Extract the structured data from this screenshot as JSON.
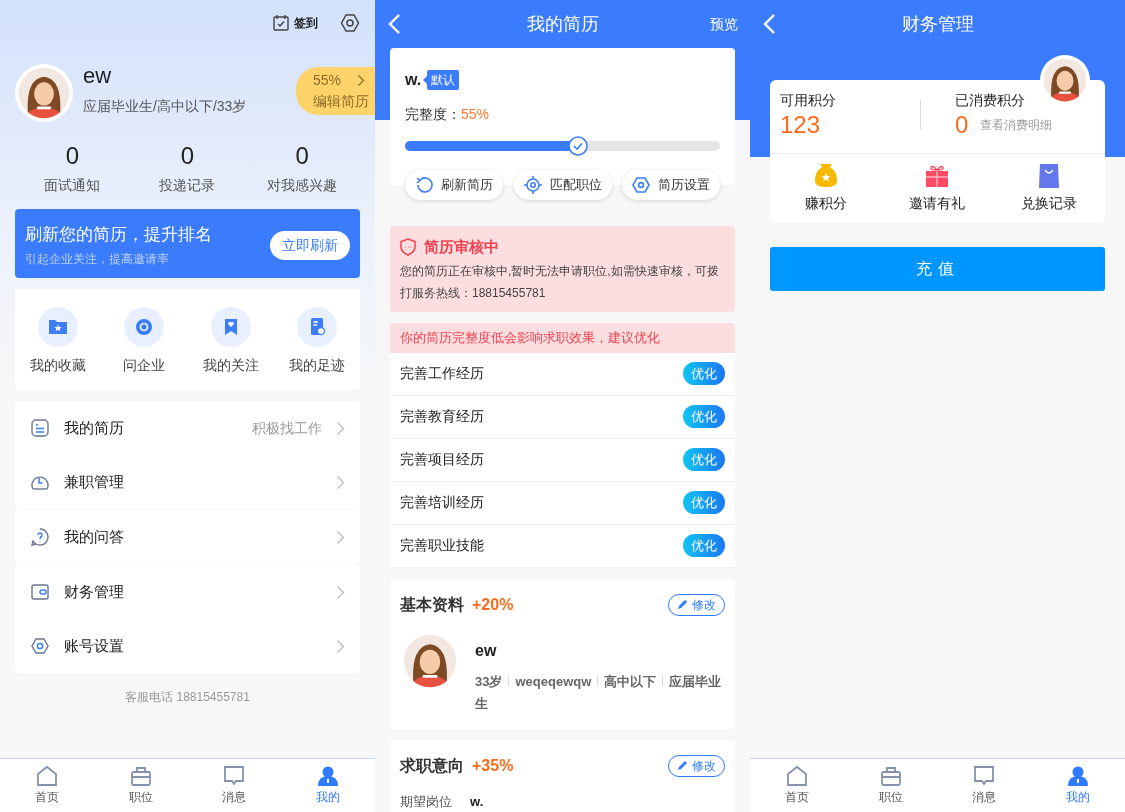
{
  "profile": {
    "sign_in": "签到",
    "name": "ew",
    "subtitle": "应届毕业生/高中以下/33岁",
    "completion": "55%",
    "edit_resume": "编辑简历",
    "stats": [
      {
        "value": "0",
        "label": "面试通知"
      },
      {
        "value": "0",
        "label": "投递记录"
      },
      {
        "value": "0",
        "label": "对我感兴趣"
      }
    ],
    "banner": {
      "title": "刷新您的简历，提升排名",
      "subtitle": "引起企业关注，提高邀请率",
      "button": "立即刷新"
    },
    "shortcuts": [
      "我的收藏",
      "问企业",
      "我的关注",
      "我的足迹"
    ],
    "menu_groups": [
      {
        "items": [
          {
            "label": "我的简历",
            "value": "积极找工作"
          },
          {
            "label": "兼职管理"
          }
        ]
      },
      {
        "items": [
          {
            "label": "我的问答"
          }
        ]
      },
      {
        "items": [
          {
            "label": "财务管理"
          },
          {
            "label": "账号设置"
          }
        ]
      }
    ],
    "hotline": "客服电话 18815455781",
    "tab_bar": [
      {
        "label": "首页",
        "selected": false
      },
      {
        "label": "职位",
        "selected": false
      },
      {
        "label": "消息",
        "selected": false
      },
      {
        "label": "我的",
        "selected": true
      }
    ]
  },
  "resume": {
    "title": "我的简历",
    "preview": "预览",
    "name": "w.",
    "tag": "默认",
    "completeness_label": "完整度：",
    "completeness": "55%",
    "level": 0.55,
    "actions": [
      "刷新简历",
      "匹配职位",
      "简历设置"
    ],
    "review": {
      "title": "简历审核中",
      "text": "您的简历正在审核中,暂时无法申请职位,如需快速审核，可拨打服务热线：18815455781"
    },
    "warning": "你的简历完整度低会影响求职效果，建议优化",
    "tasks": [
      {
        "label": "完善工作经历",
        "button": "优化"
      },
      {
        "label": "完善教育经历",
        "button": "优化"
      },
      {
        "label": "完善项目经历",
        "button": "优化"
      },
      {
        "label": "完善培训经历",
        "button": "优化"
      },
      {
        "label": "完善职业技能",
        "button": "优化"
      }
    ],
    "basic": {
      "title": "基本资料",
      "bonus": "+20%",
      "edit": "修改",
      "name": "ew",
      "details": [
        "33岁",
        "weqeqewqw",
        "高中以下",
        "应届毕业生"
      ]
    },
    "intent": {
      "title": "求职意向",
      "bonus": "+35%",
      "edit": "修改",
      "fields": [
        {
          "label": "期望岗位",
          "value": "w."
        }
      ]
    }
  },
  "finance": {
    "title": "财务管理",
    "available_label": "可用积分",
    "available": "123",
    "spent_label": "已消费积分",
    "spent": "0",
    "spent_link": "查看消费明细",
    "actions": [
      "赚积分",
      "邀请有礼",
      "兑换记录"
    ],
    "recharge": "充值",
    "tab_bar": [
      {
        "label": "首页",
        "selected": false
      },
      {
        "label": "职位",
        "selected": false
      },
      {
        "label": "消息",
        "selected": false
      },
      {
        "label": "我的",
        "selected": true
      }
    ]
  }
}
